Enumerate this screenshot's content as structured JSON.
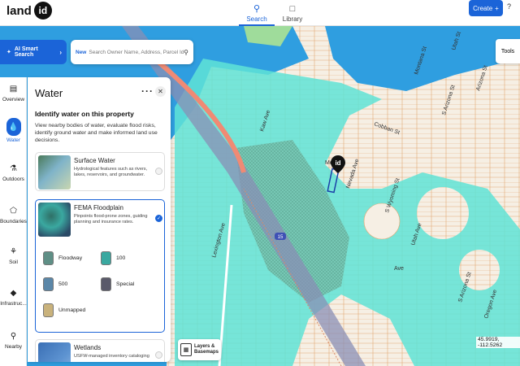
{
  "header": {
    "logo_text": "land",
    "logo_badge": "id",
    "tabs": [
      {
        "label": "Search",
        "icon": "search-icon",
        "active": true
      },
      {
        "label": "Library",
        "icon": "library-icon",
        "active": false
      }
    ],
    "create_label": "Create",
    "help_label": "?"
  },
  "search": {
    "ai_label": "AI Smart Search",
    "new_badge": "New",
    "placeholder": "Search Owner Name, Address, Parcel Id"
  },
  "tools_label": "Tools",
  "rail": [
    {
      "label": "Overview",
      "icon": "chart-icon",
      "active": false
    },
    {
      "label": "Water",
      "icon": "water-drop-icon",
      "active": true
    },
    {
      "label": "Outdoors",
      "icon": "tree-icon",
      "active": false
    },
    {
      "label": "Boundaries",
      "icon": "boundary-icon",
      "active": false
    },
    {
      "label": "Soil",
      "icon": "sprout-icon",
      "active": false
    },
    {
      "label": "Infrastruc...",
      "icon": "road-icon",
      "active": false
    },
    {
      "label": "Nearby",
      "icon": "pin-icon",
      "active": false
    }
  ],
  "panel": {
    "title": "Water",
    "subtitle": "Identify water on this property",
    "description": "View nearby bodies of water, evaluate flood risks, identify ground water and make informed land use decisions.",
    "cards": [
      {
        "title": "Surface Water",
        "description": "Hydrological features such as rivers, lakes, reservoirs, and groundwater.",
        "selected": false
      },
      {
        "title": "FEMA Floodplain",
        "description": "Pinpoints flood-prone zones, guiding planning and insurance rates.",
        "selected": true
      },
      {
        "title": "Wetlands",
        "description": "USFW-managed inventory cataloging",
        "selected": false
      }
    ],
    "legend": [
      {
        "label": "Floodway",
        "color": "#5f8f86"
      },
      {
        "label": "100",
        "color": "#3aa8a0"
      },
      {
        "label": "500",
        "color": "#5b87a8"
      },
      {
        "label": "Special",
        "color": "#5a5a6a"
      },
      {
        "label": "Unmapped",
        "color": "#c9b27c"
      }
    ]
  },
  "layers_button": {
    "line1": "Layers &",
    "line2": "Basemaps"
  },
  "coordinates": "45.9919, -112.5262",
  "map": {
    "streets": [
      "Kaw Ave",
      "Lexington Ave",
      "Cobban St",
      "Nevada Ave",
      "S Wyoming St",
      "Utah Ave",
      "S Arizona St",
      "Oregon Ave",
      "Arizona St",
      "Ave",
      "Mo",
      "S Arizona St",
      "Utah St",
      "Montana St"
    ],
    "highway_shield": "15",
    "marker_label": "id",
    "colors": {
      "water": "#2f9ee0",
      "flood": "#5fe3d6",
      "land": "#f4f0e8",
      "parcel": "#e8b98a"
    }
  }
}
